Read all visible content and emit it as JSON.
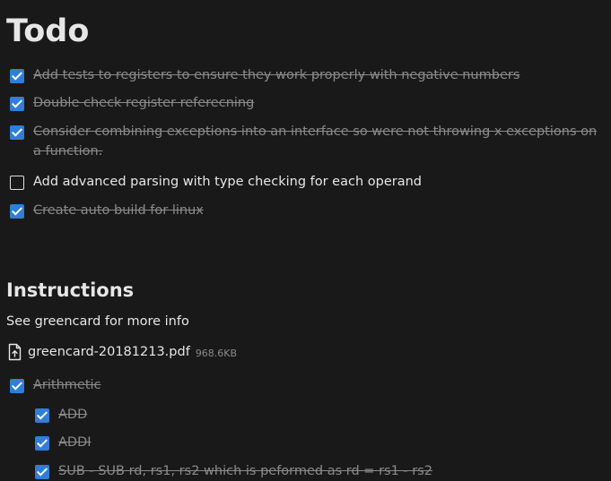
{
  "todo_section": {
    "title": "Todo",
    "items": [
      {
        "text": "Add tests to registers to ensure they work properly with negative numbers",
        "checked": true
      },
      {
        "text": "Double check register referecning",
        "checked": true
      },
      {
        "text": "Consider combining exceptions into an interface so were not throwing x exceptions on a function.",
        "checked": true
      },
      {
        "text": "Add advanced parsing with type checking for each operand",
        "checked": false
      },
      {
        "text": "Create auto build for linux",
        "checked": true
      }
    ]
  },
  "instructions_section": {
    "title": "Instructions",
    "description": "See greencard for more info",
    "attachment": {
      "icon": "file-upload-icon",
      "name": "greencard-20181213.pdf",
      "size": "968.6KB"
    },
    "items": [
      {
        "text": "Arithmetic",
        "checked": true
      },
      {
        "text": "ADD",
        "checked": true
      },
      {
        "text": "ADDI",
        "checked": true
      },
      {
        "text": "SUB - SUB rd, rs1, rs2 which is peformed as rd = rs1 - rs2",
        "checked": true
      }
    ]
  },
  "colors": {
    "background": "#191919",
    "text": "#e6e6e6",
    "muted_text": "#8a8a8a",
    "checkbox_accent": "#2f7ed8"
  }
}
